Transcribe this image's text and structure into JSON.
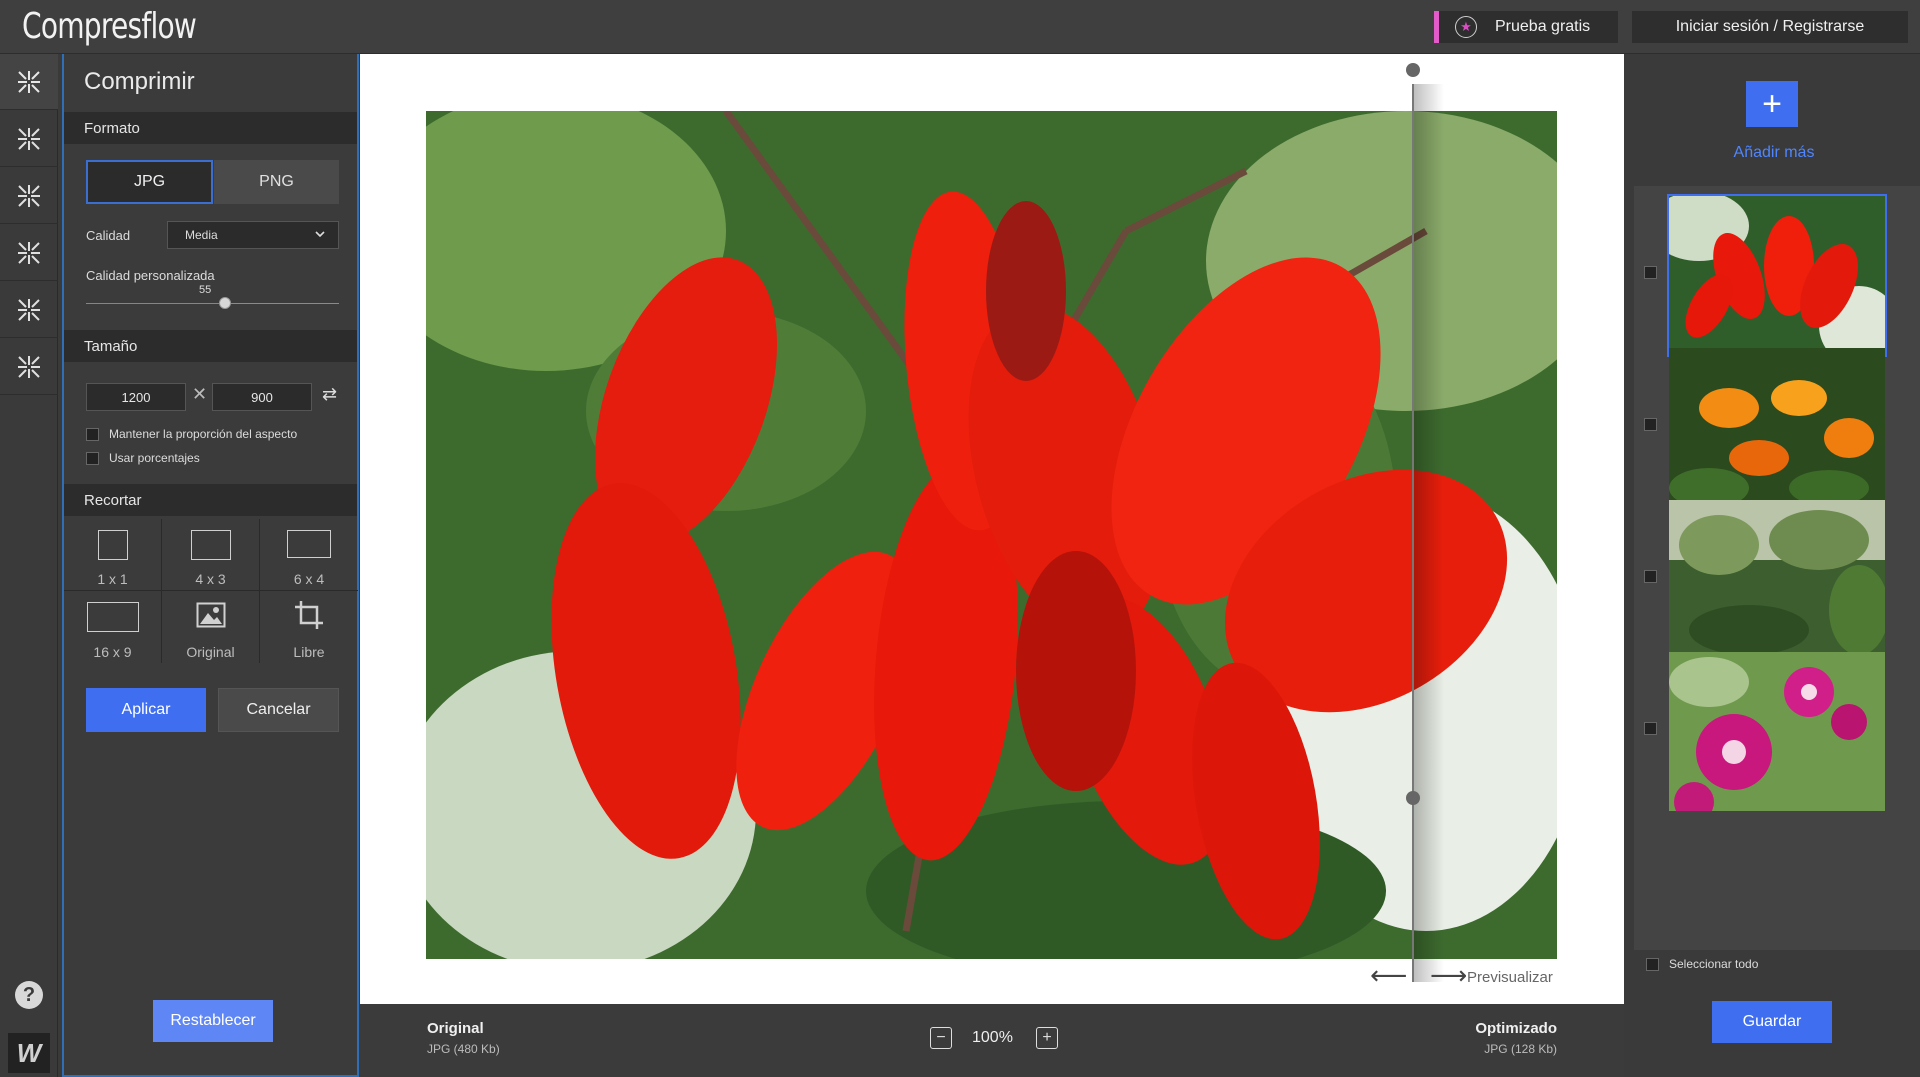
{
  "app": {
    "logo": "Compresflow"
  },
  "header": {
    "trial_label": "Prueba gratis",
    "login_label": "Iniciar sesión / Registrarse"
  },
  "panel": {
    "title": "Comprimir",
    "format_section": "Formato",
    "format_options": [
      "JPG",
      "PNG"
    ],
    "selected_format": "JPG",
    "quality_label": "Calidad",
    "quality_value": "Media",
    "custom_quality_label": "Calidad personalizada",
    "custom_quality_value": "55",
    "custom_quality_fraction": 0.55,
    "size_section": "Tamaño",
    "width": "1200",
    "height": "900",
    "keep_aspect_label": "Mantener la proporción del aspecto",
    "use_percent_label": "Usar porcentajes",
    "crop_section": "Recortar",
    "crop_options": [
      "1 x 1",
      "4 x 3",
      "6 x 4",
      "16 x 9",
      "Original",
      "Libre"
    ],
    "apply_label": "Aplicar",
    "cancel_label": "Cancelar",
    "reset_label": "Restablecer"
  },
  "canvas": {
    "preview_label": "Previsualizar"
  },
  "bottom": {
    "original_title": "Original",
    "original_info": "JPG (480 Kb)",
    "zoom": "100%",
    "optimized_title": "Optimizado",
    "optimized_info": "JPG (128 Kb)"
  },
  "right": {
    "add_more_label": "Añadir más",
    "select_all_label": "Seleccionar todo",
    "save_label": "Guardar"
  },
  "colors": {
    "accent": "#3f6ff0",
    "trial_marker": "#e25bc8",
    "panel_border": "#2f6fb7"
  }
}
